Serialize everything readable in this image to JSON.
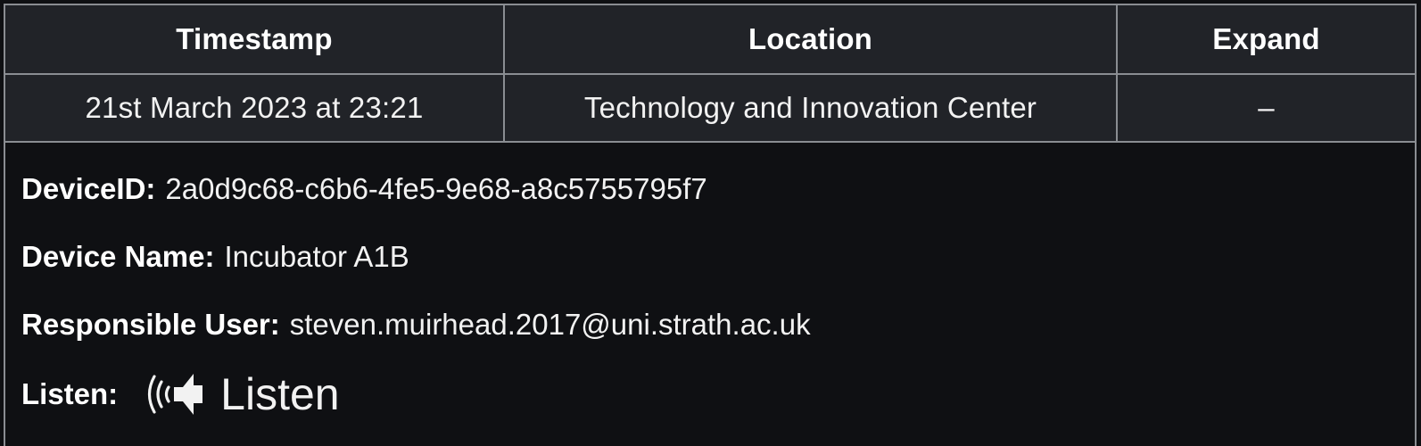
{
  "table": {
    "headers": {
      "timestamp": "Timestamp",
      "location": "Location",
      "expand": "Expand"
    },
    "row": {
      "timestamp": "21st March 2023 at 23:21",
      "location": "Technology and Innovation Center",
      "expand": "–"
    }
  },
  "details": {
    "device_id_label": "DeviceID:",
    "device_id": "2a0d9c68-c6b6-4fe5-9e68-a8c5755795f7",
    "device_name_label": "Device Name:",
    "device_name": "Incubator A1B",
    "responsible_user_label": "Responsible User:",
    "responsible_user": "steven.muirhead.2017@uni.strath.ac.uk",
    "listen_label": "Listen:",
    "listen_button": "Listen",
    "listen_icon": "speaker-sound-icon"
  },
  "colors": {
    "background": "#0f1013",
    "cell_background": "#212328",
    "border": "#8a8d92",
    "text": "#ffffff"
  }
}
